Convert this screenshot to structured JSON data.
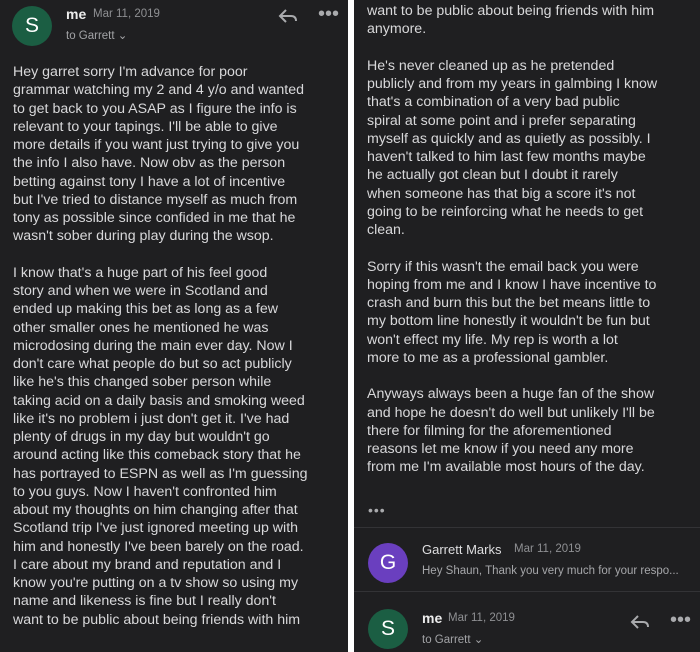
{
  "left_panel": {
    "header": {
      "avatar_letter": "S",
      "sender": "me",
      "date": "Mar 11, 2019",
      "recipient": "to Garrett",
      "reply_icon": "reply-arrow-icon",
      "more_icon": "more-horizontal-icon"
    },
    "body_lines": [
      "Hey garret sorry I'm advance for poor",
      "grammar watching my 2 and 4 y/o and wanted",
      "to get back to you ASAP as I figure the info is",
      "relevant to your tapings. I'll be able to give",
      "more details if you want just trying to give you",
      "the info I also have. Now obv as the person",
      "betting against tony I have a lot of incentive",
      "but I've tried to distance myself as much from",
      "tony as possible since confided in me that he",
      "wasn't sober during play during the wsop.",
      "",
      "I know that's a huge part of his feel good",
      "story and when we were in Scotland and",
      "ended up making this bet as long as a few",
      "other smaller ones he mentioned he was",
      "microdosing during the main ever day. Now I",
      "don't care what people do but so act publicly",
      "like he's this changed sober person while",
      "taking acid on a daily basis and smoking weed",
      "like it's no problem i just don't get it. I've had",
      "plenty of drugs in my day but wouldn't go",
      "around acting like this comeback story that he",
      "has portrayed to ESPN as well as I'm guessing",
      "to you guys. Now I haven't confronted him",
      "about my thoughts on him changing after that",
      "Scotland trip I've just ignored meeting up with",
      "him and honestly I've been barely on the road.",
      "I care about my brand and reputation and I",
      "know you're putting on a tv show so using my",
      "name and likeness is fine but I really don't",
      "want to be public about being friends with him"
    ]
  },
  "right_panel": {
    "body_lines": [
      "want to be public about being friends with him",
      "anymore.",
      "",
      "He's never cleaned up as he pretended",
      "publicly and from my years in galmbing I know",
      "that's a combination of a very bad public",
      "spiral at some point and i prefer separating",
      "myself as quickly and as quietly as possibly. I",
      "haven't talked to him last few months maybe",
      "he actually got clean but I doubt it rarely",
      "when someone has that big a score it's not",
      "going to be reinforcing what he needs to get",
      "clean.",
      "",
      "Sorry if this wasn't the email back you were",
      "hoping from me and I know I have incentive to",
      "crash and burn this but the bet means little to",
      "my bottom line honestly it wouldn't be fun but",
      "won't effect my life. My rep is worth a lot",
      "more to me as a professional gambler.",
      "",
      "Anyways always been a huge fan of the show",
      "and hope he doesn't do well but unlikely I'll be",
      "there for filming for the aforementioned",
      "reasons let me know if you need any more",
      "from me I'm available most hours of the day."
    ],
    "expand_dots": "•••",
    "reply_message": {
      "avatar_letter": "G",
      "sender": "Garrett Marks",
      "date": "Mar 11, 2019",
      "snippet": "Hey Shaun, Thank you very much for your respo..."
    },
    "bottom_message": {
      "avatar_letter": "S",
      "sender": "me",
      "date": "Mar 11, 2019",
      "recipient": "to Garrett",
      "reply_icon": "reply-arrow-icon",
      "more_icon": "more-horizontal-icon"
    }
  },
  "colors": {
    "background": "#1f1f21",
    "avatar_s": "#1b5e43",
    "avatar_g": "#6a3fbf",
    "text": "#d8d8da"
  }
}
